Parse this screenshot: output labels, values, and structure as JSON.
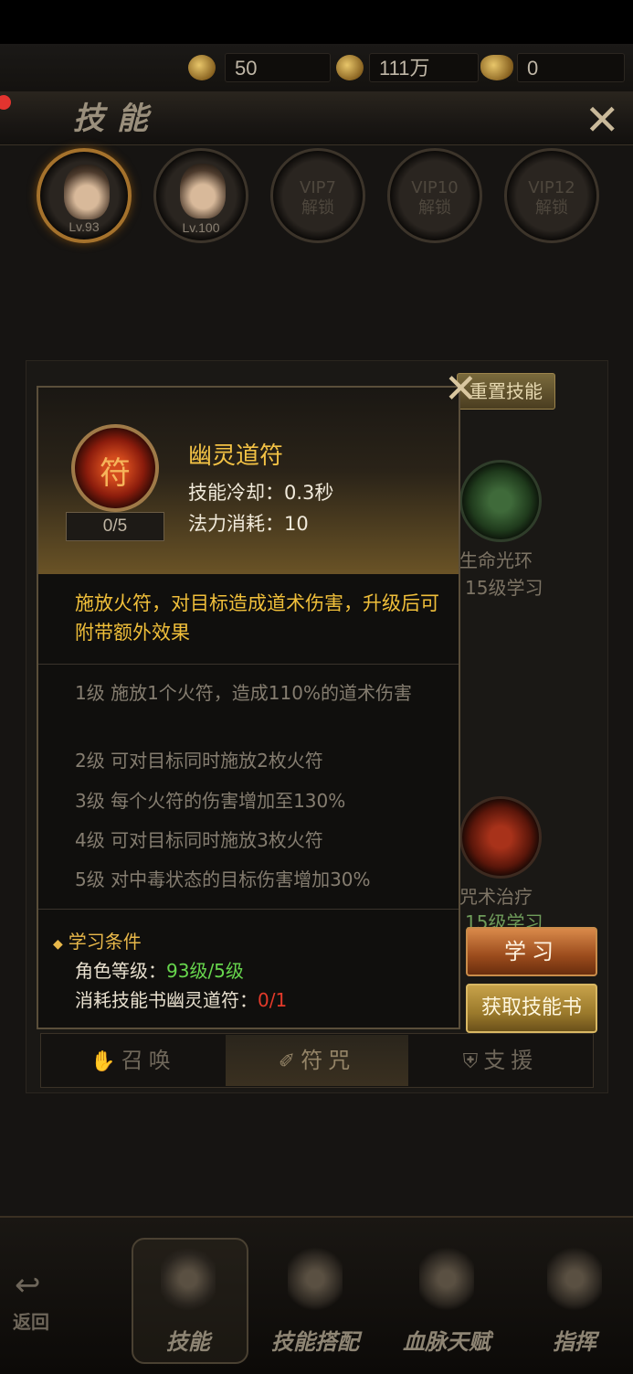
{
  "resources": [
    {
      "icon": "token-icon",
      "value": "50"
    },
    {
      "icon": "coin-icon",
      "value": "111万"
    },
    {
      "icon": "ingot-icon",
      "value": "0"
    }
  ],
  "header": {
    "title": "技能"
  },
  "characters": [
    {
      "label": "Lv.93",
      "selected": true
    },
    {
      "label": "Lv.100",
      "selected": false
    },
    {
      "lock": "VIP7\n解锁"
    },
    {
      "lock": "VIP10\n解锁"
    },
    {
      "lock": "VIP12\n解锁"
    }
  ],
  "background": {
    "reset_label": "重置技能",
    "skill_right_1": "生命光环",
    "skill_right_1_req": "15级学习",
    "skill_right_2": "咒术治疗",
    "skill_right_2_req": "15级学习"
  },
  "popup": {
    "skill_name": "幽灵道符",
    "level": "0/5",
    "cooldown": "技能冷却：0.3秒",
    "mana": "法力消耗：10",
    "description": "施放火符，对目标造成道术伤害，升级后可附带额外效果",
    "levels": [
      "1级 施放1个火符，造成110%的道术伤害",
      "2级 可对目标同时施放2枚火符",
      "3级 每个火符的伤害增加至130%",
      "4级 可对目标同时施放3枚火符",
      "5级 对中毒状态的目标伤害增加30%"
    ],
    "conditions": {
      "title": "学习条件",
      "level_label": "角色等级：",
      "level_value": "93级/5级",
      "book_label": "消耗技能书幽灵道符：",
      "book_value": "0/1"
    }
  },
  "actions": {
    "learn": "学习",
    "get_book": "获取技能书"
  },
  "tabs": [
    {
      "label": "召唤",
      "icon": "summon-icon"
    },
    {
      "label": "符咒",
      "icon": "talisman-icon",
      "active": true
    },
    {
      "label": "支援",
      "icon": "shield-icon"
    }
  ],
  "nav": {
    "back": "返回",
    "items": [
      "技能",
      "技能搭配",
      "血脉天赋",
      "指挥"
    ]
  }
}
